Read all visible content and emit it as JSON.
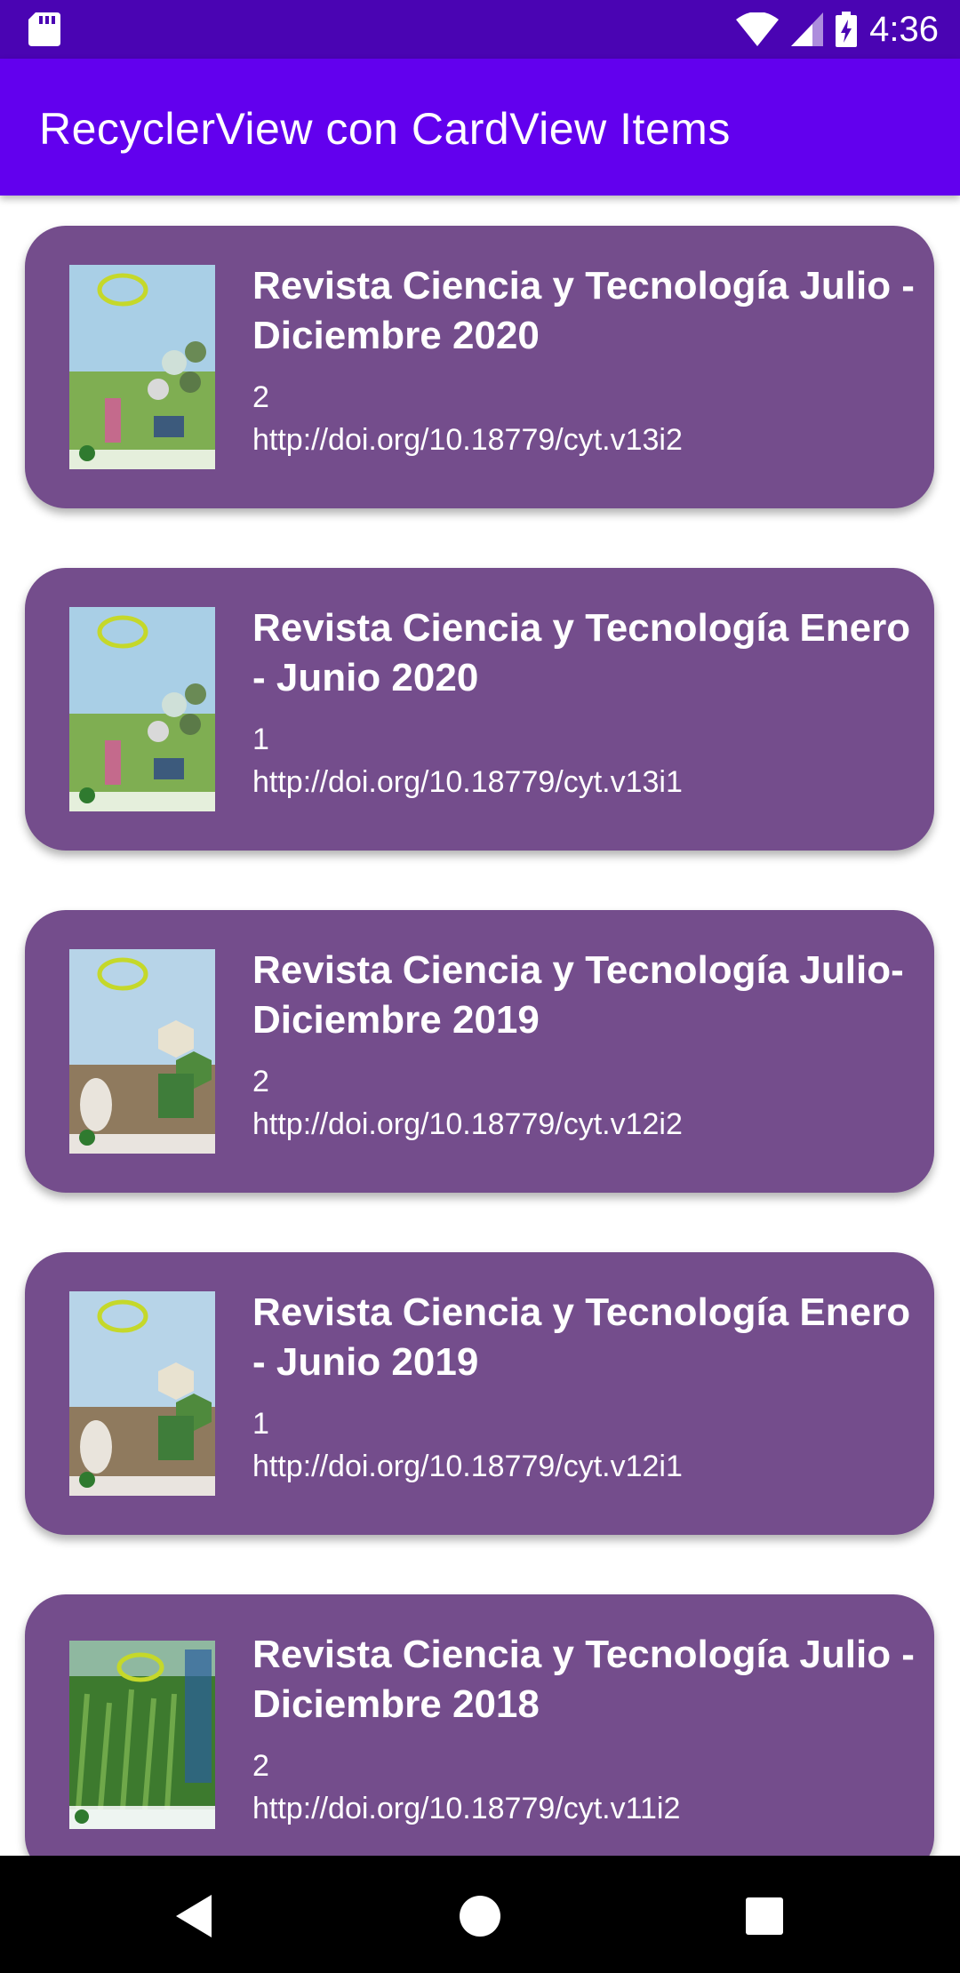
{
  "status_bar": {
    "time": "4:36",
    "icons": [
      "sd-card-icon",
      "wifi-icon",
      "signal-icon",
      "battery-charging-icon"
    ]
  },
  "app_bar": {
    "title": "RecyclerView con CardView Items"
  },
  "cards": [
    {
      "title": "Revista Ciencia y Tecnología Julio - Diciembre 2020",
      "number": "2",
      "doi": "http://doi.org/10.18779/cyt.v13i2"
    },
    {
      "title": "Revista Ciencia y Tecnología Enero - Junio 2020",
      "number": "1",
      "doi": "http://doi.org/10.18779/cyt.v13i1"
    },
    {
      "title": "Revista Ciencia y Tecnología Julio- Diciembre 2019",
      "number": "2",
      "doi": "http://doi.org/10.18779/cyt.v12i2"
    },
    {
      "title": "Revista Ciencia y Tecnología Enero - Junio 2019",
      "number": "1",
      "doi": "http://doi.org/10.18779/cyt.v12i1"
    },
    {
      "title": "Revista Ciencia y Tecnología Julio - Diciembre 2018",
      "number": "2",
      "doi": "http://doi.org/10.18779/cyt.v11i2"
    }
  ],
  "nav_bar": {
    "icons": [
      "back-icon",
      "home-icon",
      "recents-icon"
    ]
  },
  "colors": {
    "status_bar": "#4a04b3",
    "app_bar": "#6200ee",
    "card": "#744d8c",
    "nav_bar": "#000000"
  }
}
